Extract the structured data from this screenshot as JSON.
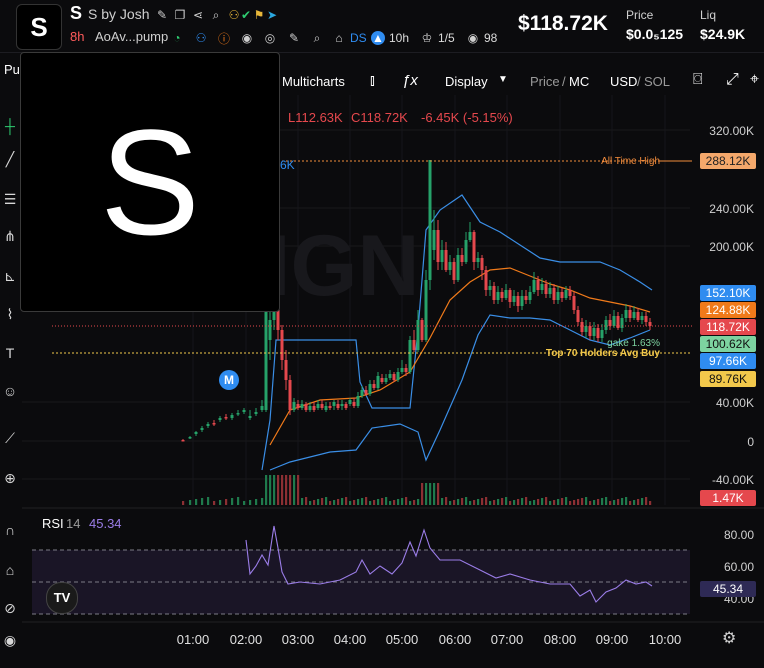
{
  "header": {
    "ticker": "S",
    "name": "S by Josh",
    "age": "8h",
    "address": "AoAv...pump",
    "market_cap": "$118.72K",
    "price_label": "Price",
    "price_value": "$0.0₅125",
    "liq_label": "Liq",
    "liq_value": "$24.9K",
    "ds_label": "DS",
    "time_ago": "10h",
    "ratio": "1/5",
    "views": "98"
  },
  "toolbar": {
    "partial_left": "Pu",
    "multicharts": "Multicharts",
    "display": "Display",
    "price_label": "Price",
    "separator": "/",
    "mc_label": "MC",
    "usd_label": "USD",
    "sol_label": "SOL"
  },
  "ohlc": {
    "low": "L112.63K",
    "close": "C118.72K",
    "change": "-6.45K (-5.15%)",
    "partial_value": "6K"
  },
  "popup": {
    "letter": "S"
  },
  "chart_data": {
    "type": "candlestick",
    "y_axis": {
      "min": -40000,
      "max": 320000,
      "ticks": [
        "320.00K",
        "240.00K",
        "200.00K",
        "40.00K",
        "0",
        "-40.00K"
      ]
    },
    "x_axis": {
      "ticks": [
        "01:00",
        "02:00",
        "03:00",
        "04:00",
        "05:00",
        "06:00",
        "07:00",
        "08:00",
        "09:00",
        "10:00"
      ]
    },
    "watermark": "GMGN",
    "annotations": [
      {
        "label": "All Time High",
        "value": "288.12K",
        "color": "#f28c3c"
      },
      {
        "label": "Top 70 Holders Avg Buy",
        "value": "89.76K",
        "color": "#f2c84b"
      },
      {
        "label": "gake 1.63%",
        "value": "100.62K",
        "color": "#7dd3a0"
      }
    ],
    "price_tags": [
      {
        "value": "152.10K",
        "color": "#2f8cf0"
      },
      {
        "value": "124.88K",
        "color": "#f07a1a"
      },
      {
        "value": "118.72K",
        "color": "#e5484d"
      },
      {
        "value": "100.62K",
        "color": "#7dd3a0"
      },
      {
        "value": "97.66K",
        "color": "#2f8cf0"
      },
      {
        "value": "89.76K",
        "color": "#f2c84b"
      },
      {
        "value": "1.47K",
        "color": "#e5484d"
      }
    ],
    "marker": "M",
    "candles": [
      [
        183,
        440,
        440,
        439,
        441
      ],
      [
        190,
        438,
        437,
        436,
        439
      ],
      [
        196,
        434,
        432,
        431,
        436
      ],
      [
        202,
        430,
        428,
        426,
        432
      ],
      [
        208,
        426,
        424,
        422,
        428
      ],
      [
        214,
        423,
        424,
        420,
        426
      ],
      [
        220,
        420,
        418,
        416,
        422
      ],
      [
        226,
        417,
        418,
        414,
        420
      ],
      [
        232,
        418,
        415,
        413,
        420
      ],
      [
        238,
        414,
        413,
        410,
        416
      ],
      [
        244,
        412,
        410,
        408,
        414
      ],
      [
        250,
        418,
        416,
        410,
        420
      ],
      [
        256,
        414,
        412,
        408,
        416
      ],
      [
        262,
        410,
        406,
        400,
        412
      ],
      [
        266,
        410,
        300,
        300,
        412
      ],
      [
        270,
        340,
        320,
        310,
        360
      ],
      [
        274,
        320,
        270,
        265,
        330
      ],
      [
        278,
        280,
        330,
        275,
        340
      ],
      [
        282,
        330,
        360,
        325,
        370
      ],
      [
        286,
        360,
        380,
        350,
        390
      ],
      [
        290,
        380,
        410,
        375,
        415
      ],
      [
        294,
        410,
        402,
        398,
        412
      ],
      [
        298,
        404,
        408,
        400,
        410
      ],
      [
        302,
        408,
        404,
        400,
        410
      ],
      [
        306,
        404,
        410,
        402,
        412
      ],
      [
        310,
        410,
        406,
        402,
        412
      ],
      [
        314,
        406,
        410,
        402,
        412
      ],
      [
        318,
        408,
        404,
        400,
        410
      ],
      [
        322,
        404,
        408,
        400,
        410
      ],
      [
        326,
        410,
        406,
        402,
        412
      ],
      [
        330,
        406,
        408,
        402,
        410
      ],
      [
        334,
        406,
        402,
        400,
        410
      ],
      [
        338,
        404,
        408,
        400,
        410
      ],
      [
        342,
        406,
        404,
        400,
        410
      ],
      [
        346,
        404,
        408,
        402,
        410
      ],
      [
        350,
        404,
        400,
        398,
        406
      ],
      [
        354,
        402,
        406,
        398,
        408
      ],
      [
        358,
        406,
        396,
        392,
        408
      ],
      [
        362,
        396,
        390,
        386,
        398
      ],
      [
        366,
        390,
        394,
        386,
        396
      ],
      [
        370,
        394,
        384,
        380,
        396
      ],
      [
        374,
        384,
        388,
        380,
        390
      ],
      [
        378,
        388,
        376,
        372,
        390
      ],
      [
        382,
        378,
        382,
        374,
        384
      ],
      [
        386,
        382,
        378,
        374,
        384
      ],
      [
        390,
        378,
        374,
        370,
        380
      ],
      [
        394,
        374,
        380,
        372,
        382
      ],
      [
        398,
        380,
        372,
        368,
        382
      ],
      [
        402,
        372,
        368,
        360,
        374
      ],
      [
        406,
        368,
        372,
        364,
        376
      ],
      [
        410,
        372,
        340,
        336,
        374
      ],
      [
        414,
        340,
        350,
        330,
        352
      ],
      [
        418,
        350,
        320,
        310,
        352
      ],
      [
        422,
        320,
        340,
        318,
        342
      ],
      [
        426,
        340,
        280,
        270,
        342
      ],
      [
        430,
        280,
        160,
        160,
        290
      ],
      [
        434,
        250,
        230,
        210,
        260
      ],
      [
        438,
        230,
        262,
        220,
        270
      ],
      [
        442,
        262,
        250,
        240,
        270
      ],
      [
        446,
        250,
        270,
        242,
        272
      ],
      [
        450,
        270,
        262,
        255,
        275
      ],
      [
        454,
        262,
        280,
        258,
        284
      ],
      [
        458,
        280,
        255,
        248,
        282
      ],
      [
        462,
        255,
        262,
        248,
        266
      ],
      [
        466,
        262,
        240,
        232,
        264
      ],
      [
        470,
        240,
        232,
        222,
        242
      ],
      [
        474,
        232,
        262,
        230,
        270
      ],
      [
        478,
        262,
        258,
        252,
        268
      ],
      [
        482,
        258,
        270,
        255,
        280
      ],
      [
        486,
        270,
        290,
        266,
        296
      ],
      [
        490,
        290,
        286,
        280,
        296
      ],
      [
        494,
        286,
        300,
        282,
        304
      ],
      [
        498,
        300,
        292,
        286,
        304
      ],
      [
        502,
        292,
        298,
        288,
        302
      ],
      [
        506,
        298,
        290,
        284,
        300
      ],
      [
        510,
        290,
        302,
        288,
        308
      ],
      [
        514,
        302,
        296,
        290,
        306
      ],
      [
        518,
        296,
        306,
        292,
        312
      ],
      [
        522,
        306,
        296,
        290,
        310
      ],
      [
        526,
        296,
        300,
        290,
        304
      ],
      [
        530,
        300,
        292,
        286,
        304
      ],
      [
        534,
        292,
        280,
        272,
        294
      ],
      [
        538,
        280,
        290,
        276,
        296
      ],
      [
        542,
        290,
        284,
        278,
        294
      ],
      [
        546,
        284,
        294,
        280,
        298
      ],
      [
        550,
        294,
        288,
        282,
        298
      ],
      [
        554,
        288,
        300,
        284,
        304
      ],
      [
        558,
        300,
        292,
        286,
        304
      ],
      [
        562,
        292,
        298,
        288,
        302
      ],
      [
        566,
        298,
        290,
        286,
        300
      ],
      [
        570,
        290,
        296,
        286,
        300
      ],
      [
        574,
        296,
        310,
        292,
        314
      ],
      [
        578,
        310,
        322,
        306,
        326
      ],
      [
        582,
        322,
        332,
        318,
        336
      ],
      [
        586,
        332,
        326,
        320,
        338
      ],
      [
        590,
        326,
        336,
        322,
        340
      ],
      [
        594,
        336,
        328,
        322,
        340
      ],
      [
        598,
        328,
        338,
        324,
        342
      ],
      [
        602,
        338,
        330,
        324,
        342
      ],
      [
        606,
        330,
        320,
        316,
        334
      ],
      [
        610,
        320,
        326,
        314,
        330
      ],
      [
        614,
        326,
        316,
        310,
        328
      ],
      [
        618,
        316,
        328,
        312,
        330
      ],
      [
        622,
        328,
        318,
        314,
        332
      ],
      [
        626,
        318,
        310,
        304,
        322
      ],
      [
        630,
        310,
        318,
        306,
        322
      ],
      [
        634,
        318,
        312,
        306,
        320
      ],
      [
        638,
        312,
        320,
        308,
        322
      ],
      [
        642,
        320,
        316,
        312,
        324
      ],
      [
        646,
        316,
        322,
        312,
        326
      ],
      [
        650,
        322,
        326,
        318,
        330
      ]
    ],
    "rsi": {
      "label": "RSI",
      "period": "14",
      "value": "45.34",
      "ticks": [
        "80.00",
        "60.00",
        "40.00"
      ]
    }
  },
  "left_tools": [
    "crosshair-icon",
    "trendline-icon",
    "fib-icon",
    "brush-icon",
    "measure-icon",
    "pattern-icon",
    "text-icon",
    "emoji-icon",
    "ruler-icon",
    "zoom-icon",
    "magnet-icon",
    "lock-icon",
    "eye-icon"
  ]
}
